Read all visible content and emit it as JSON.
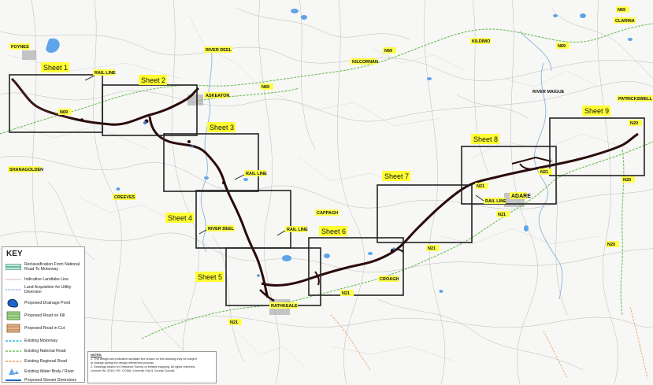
{
  "places": [
    {
      "id": "foynes",
      "label": "FOYNES"
    },
    {
      "id": "shanagolden",
      "label": "SHANAGOLDEN"
    },
    {
      "id": "creeves",
      "label": "CREEVES"
    },
    {
      "id": "askeaton",
      "label": "ASKEATON"
    },
    {
      "id": "river-deel-top",
      "label": "RIVER DEEL"
    },
    {
      "id": "river-deel-mid",
      "label": "RIVER DEEL"
    },
    {
      "id": "kilcornan",
      "label": "KILCORNAN"
    },
    {
      "id": "kildimo",
      "label": "KILDIMO"
    },
    {
      "id": "clarina",
      "label": "CLARINA"
    },
    {
      "id": "patrickswell",
      "label": "PATRICKSWELL"
    },
    {
      "id": "river-maigue",
      "label": "RIVER MAIGUE"
    },
    {
      "id": "adare",
      "label": "ADARE"
    },
    {
      "id": "cappagh",
      "label": "CAPPAGH"
    },
    {
      "id": "croagh",
      "label": "CROAGH"
    },
    {
      "id": "rathkeale",
      "label": "RATHKEALE"
    },
    {
      "id": "rail-line-1",
      "label": "RAIL LINE"
    },
    {
      "id": "rail-line-2",
      "label": "RAIL LINE"
    },
    {
      "id": "rail-line-3",
      "label": "RAIL LINE"
    },
    {
      "id": "rail-line-4",
      "label": "RAIL LINE"
    }
  ],
  "roads": [
    {
      "id": "n69-top",
      "label": "N69"
    },
    {
      "id": "n69-kil",
      "label": "N69"
    },
    {
      "id": "n69-ask",
      "label": "N69"
    },
    {
      "id": "n69-west",
      "label": "N69"
    },
    {
      "id": "n69-right",
      "label": "N69"
    },
    {
      "id": "n20-top",
      "label": "N20"
    },
    {
      "id": "n20-right",
      "label": "N20"
    },
    {
      "id": "n20-bottom",
      "label": "N20"
    },
    {
      "id": "n21-adare",
      "label": "N21"
    },
    {
      "id": "n21-east",
      "label": "N21"
    },
    {
      "id": "n21-mid",
      "label": "N21"
    },
    {
      "id": "n21-croagh",
      "label": "N21"
    },
    {
      "id": "n21-south",
      "label": "N21"
    },
    {
      "id": "n21-sheet8",
      "label": "N21"
    }
  ],
  "sheets": [
    {
      "id": 1,
      "label": "Sheet 1"
    },
    {
      "id": 2,
      "label": "Sheet 2"
    },
    {
      "id": 3,
      "label": "Sheet 3"
    },
    {
      "id": 4,
      "label": "Sheet 4"
    },
    {
      "id": 5,
      "label": "Sheet 5"
    },
    {
      "id": 6,
      "label": "Sheet 6"
    },
    {
      "id": 7,
      "label": "Sheet 7"
    },
    {
      "id": 8,
      "label": "Sheet 8"
    },
    {
      "id": 9,
      "label": "Sheet 9"
    }
  ],
  "key": {
    "title": "KEY",
    "items": [
      {
        "label": "Reclassification From National Road To Motorway",
        "symbol": "reclass"
      },
      {
        "label": "Indicative Landtake Line",
        "symbol": "landtake"
      },
      {
        "label": "Land Acquisition for Utility Diversion",
        "symbol": "utility"
      },
      {
        "label": "Proposed Drainage Pond",
        "symbol": "pond"
      },
      {
        "label": "Proposed Road on Fill",
        "symbol": "fill"
      },
      {
        "label": "Proposed Road in Cut",
        "symbol": "cut"
      },
      {
        "label": "Existing Motorway",
        "symbol": "motorway"
      },
      {
        "label": "Existing National Road",
        "symbol": "national"
      },
      {
        "label": "Existing Regional Road",
        "symbol": "regional"
      },
      {
        "label": "Existing Water Body / River",
        "symbol": "water"
      },
      {
        "label": "Proposed Stream Diversions",
        "symbol": "stream"
      }
    ]
  },
  "notes": {
    "title": "NOTES:",
    "lines": [
      "1.  The design and indicative landtake line shown on this drawing may be subject",
      "     to change during the design refinement process",
      "2.  Drawings based on Ordnance Survey of Ireland mapping. All rights reserved.",
      "     Licence No: 2018 / 09 / CCMA / Limerick City & County Council"
    ]
  },
  "colors": {
    "route": "#2a0a0a",
    "national_road": "#6cbf5a",
    "regional_road": "#e59a55",
    "water": "#5da4e8",
    "label_bg": "#ffff4d"
  }
}
